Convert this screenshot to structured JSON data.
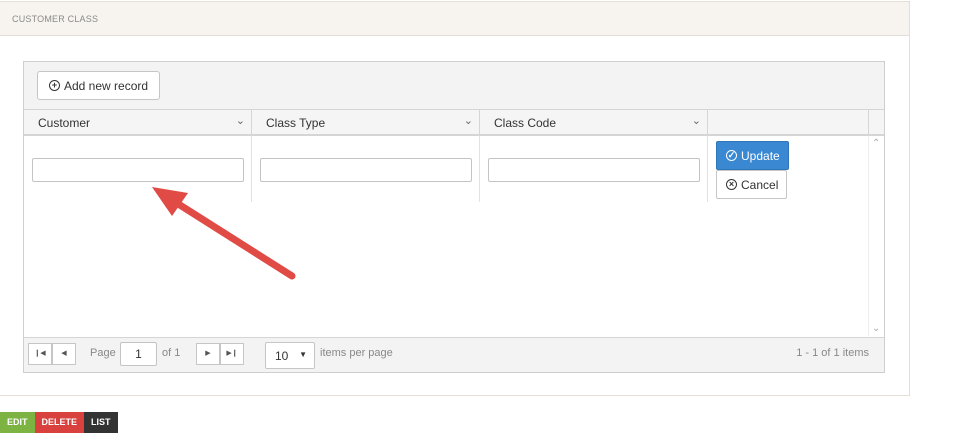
{
  "panel": {
    "title": "CUSTOMER CLASS"
  },
  "toolbar": {
    "add_label": "Add new record"
  },
  "columns": [
    {
      "label": "Customer"
    },
    {
      "label": "Class Type"
    },
    {
      "label": "Class Code"
    }
  ],
  "edit_row": {
    "customer_value": "",
    "class_type_value": "",
    "class_code_value": "",
    "update_label": "Update",
    "cancel_label": "Cancel"
  },
  "pager": {
    "page_label": "Page",
    "current_page": "1",
    "of_label": "of 1",
    "page_size": "10",
    "items_per_page_label": "items per page",
    "info": "1 - 1 of 1 items"
  },
  "actions": [
    {
      "label": "EDIT",
      "color": "#7cb342"
    },
    {
      "label": "DELETE",
      "color": "#d9413f"
    },
    {
      "label": "LIST",
      "color": "#333333"
    }
  ],
  "colors": {
    "primary_button": "#3a87d2",
    "annotation_arrow": "#e04b45"
  }
}
